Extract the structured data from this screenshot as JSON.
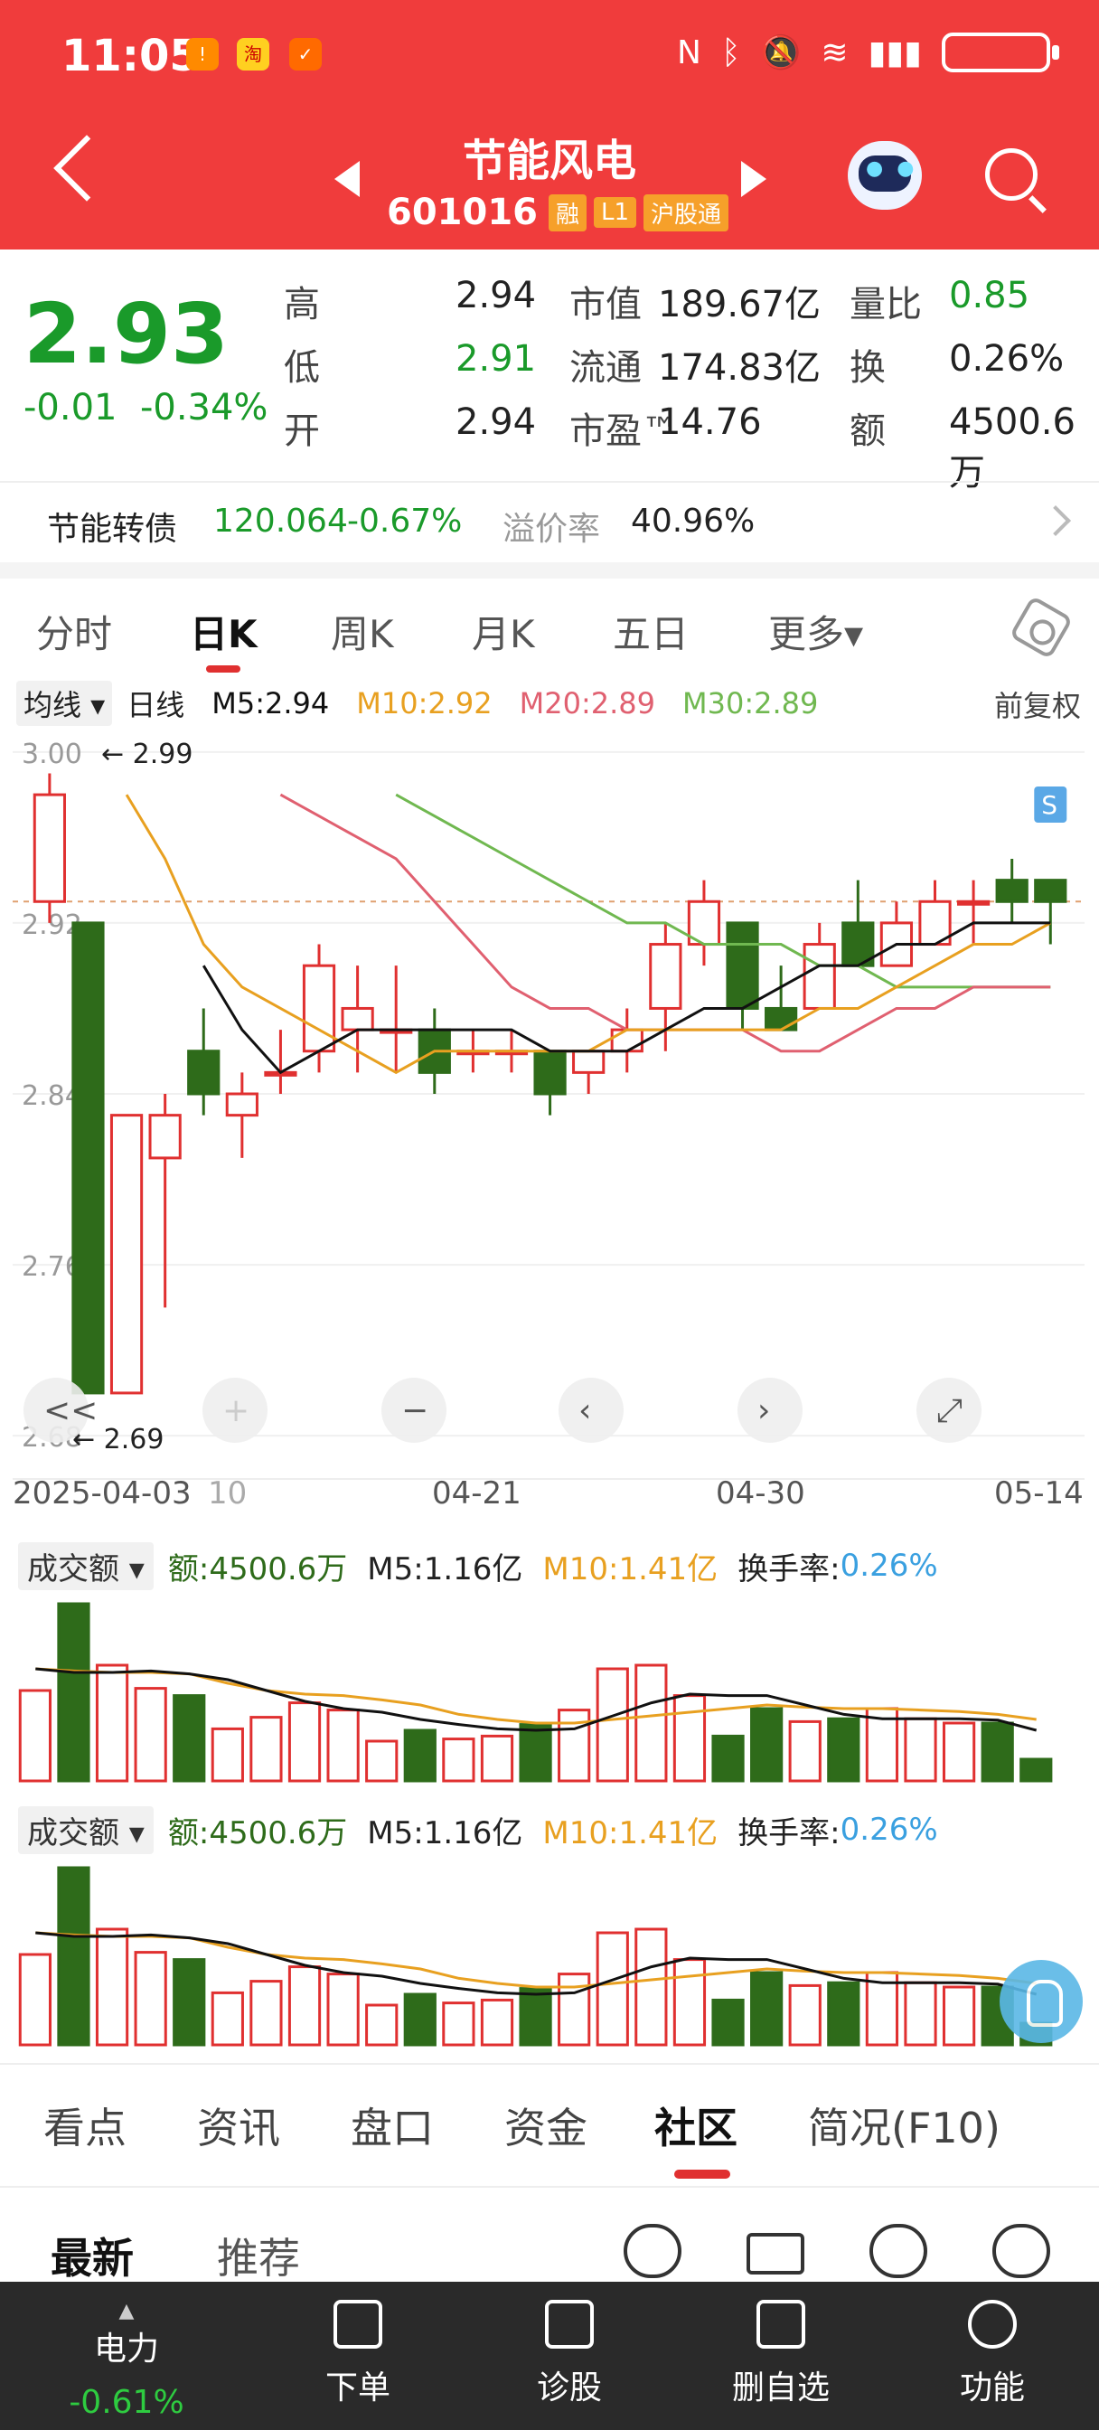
{
  "status": {
    "time": "11:05"
  },
  "header": {
    "title": "节能风电",
    "code": "601016",
    "tags": [
      "融",
      "L1",
      "沪股通"
    ]
  },
  "quote": {
    "price": "2.93",
    "change": "-0.01",
    "change_pct": "-0.34%",
    "rows": [
      {
        "label": "高",
        "value": "2.94",
        "label2": "市值",
        "value2": "189.67亿",
        "label3": "量比",
        "value3": "0.85"
      },
      {
        "label": "低",
        "value": "2.91",
        "label2": "流通",
        "value2": "174.83亿",
        "label3": "换",
        "value3": "0.26%"
      },
      {
        "label": "开",
        "value": "2.94",
        "label2": "市盈™",
        "value2": "14.76",
        "label3": "额",
        "value3": "4500.6万"
      }
    ]
  },
  "convertible": {
    "name": "节能转债",
    "price": "120.064",
    "pct": "-0.67%",
    "premium_label": "溢价率",
    "premium": "40.96%"
  },
  "ktabs": [
    "分时",
    "日K",
    "周K",
    "月K",
    "五日",
    "更多▾"
  ],
  "ma": {
    "select": "均线 ▾",
    "period": "日线",
    "m5": "M5:2.94",
    "m10": "M10:2.92",
    "m20": "M20:2.89",
    "m30": "M30:2.89",
    "adj": "前复权"
  },
  "colors": {
    "up": "#e03030",
    "down": "#2e6b1a",
    "m5": "#111111",
    "m10": "#e8a020",
    "m20": "#e06070",
    "m30": "#70b850"
  },
  "chart_data": {
    "type": "candlestick",
    "y_ticks": [
      "3.00",
      "2.92",
      "2.84",
      "2.76",
      "2.68"
    ],
    "ylim": [
      2.675,
      3.005
    ],
    "max_marker": "2.99",
    "min_marker": "2.69",
    "dates": [
      "2025-04-03",
      "04-21",
      "04-30",
      "05-14"
    ],
    "date_partial": "10",
    "candles": [
      {
        "o": 2.93,
        "h": 2.99,
        "l": 2.92,
        "c": 2.98
      },
      {
        "o": 2.92,
        "h": 2.92,
        "l": 2.7,
        "c": 2.7
      },
      {
        "o": 2.7,
        "h": 2.83,
        "l": 2.7,
        "c": 2.83
      },
      {
        "o": 2.81,
        "h": 2.84,
        "l": 2.74,
        "c": 2.83
      },
      {
        "o": 2.86,
        "h": 2.88,
        "l": 2.83,
        "c": 2.84
      },
      {
        "o": 2.83,
        "h": 2.85,
        "l": 2.81,
        "c": 2.84
      },
      {
        "o": 2.85,
        "h": 2.87,
        "l": 2.84,
        "c": 2.85
      },
      {
        "o": 2.86,
        "h": 2.91,
        "l": 2.85,
        "c": 2.9
      },
      {
        "o": 2.87,
        "h": 2.9,
        "l": 2.85,
        "c": 2.88
      },
      {
        "o": 2.87,
        "h": 2.9,
        "l": 2.85,
        "c": 2.87
      },
      {
        "o": 2.87,
        "h": 2.88,
        "l": 2.84,
        "c": 2.85
      },
      {
        "o": 2.86,
        "h": 2.87,
        "l": 2.85,
        "c": 2.86
      },
      {
        "o": 2.86,
        "h": 2.87,
        "l": 2.85,
        "c": 2.86
      },
      {
        "o": 2.86,
        "h": 2.86,
        "l": 2.83,
        "c": 2.84
      },
      {
        "o": 2.85,
        "h": 2.86,
        "l": 2.84,
        "c": 2.86
      },
      {
        "o": 2.86,
        "h": 2.88,
        "l": 2.85,
        "c": 2.87
      },
      {
        "o": 2.88,
        "h": 2.92,
        "l": 2.86,
        "c": 2.91
      },
      {
        "o": 2.91,
        "h": 2.94,
        "l": 2.9,
        "c": 2.93
      },
      {
        "o": 2.92,
        "h": 2.92,
        "l": 2.87,
        "c": 2.88
      },
      {
        "o": 2.88,
        "h": 2.9,
        "l": 2.87,
        "c": 2.87
      },
      {
        "o": 2.88,
        "h": 2.92,
        "l": 2.88,
        "c": 2.91
      },
      {
        "o": 2.92,
        "h": 2.94,
        "l": 2.9,
        "c": 2.9
      },
      {
        "o": 2.9,
        "h": 2.93,
        "l": 2.9,
        "c": 2.92
      },
      {
        "o": 2.91,
        "h": 2.94,
        "l": 2.91,
        "c": 2.93
      },
      {
        "o": 2.93,
        "h": 2.94,
        "l": 2.91,
        "c": 2.93
      },
      {
        "o": 2.94,
        "h": 2.95,
        "l": 2.92,
        "c": 2.93
      },
      {
        "o": 2.94,
        "h": 2.94,
        "l": 2.91,
        "c": 2.93
      }
    ],
    "m5": [
      null,
      null,
      null,
      null,
      2.9,
      2.87,
      2.85,
      2.86,
      2.87,
      2.87,
      2.87,
      2.87,
      2.87,
      2.86,
      2.86,
      2.86,
      2.87,
      2.88,
      2.88,
      2.89,
      2.9,
      2.9,
      2.91,
      2.91,
      2.92,
      2.92,
      2.92
    ],
    "m10": [
      null,
      null,
      2.98,
      2.95,
      2.91,
      2.89,
      2.88,
      2.87,
      2.86,
      2.85,
      2.86,
      2.86,
      2.86,
      2.86,
      2.86,
      2.87,
      2.87,
      2.87,
      2.87,
      2.87,
      2.88,
      2.88,
      2.89,
      2.9,
      2.91,
      2.91,
      2.92
    ],
    "m20": [
      null,
      null,
      null,
      null,
      null,
      null,
      2.98,
      2.97,
      2.96,
      2.95,
      2.93,
      2.91,
      2.89,
      2.88,
      2.88,
      2.87,
      2.87,
      2.87,
      2.87,
      2.86,
      2.86,
      2.87,
      2.88,
      2.88,
      2.89,
      2.89,
      2.89
    ],
    "m30": [
      null,
      null,
      null,
      null,
      null,
      null,
      null,
      null,
      null,
      2.98,
      2.97,
      2.96,
      2.95,
      2.94,
      2.93,
      2.92,
      2.92,
      2.91,
      2.91,
      2.91,
      2.9,
      2.9,
      2.89,
      2.89,
      2.89,
      2.89,
      2.89
    ],
    "signal": "S"
  },
  "volume": {
    "label": "成交额 ▾",
    "amount": "额:4500.6万",
    "m5": "M5:1.16亿",
    "m10": "M10:1.41亿",
    "turnover_label": "换手率:",
    "turnover": "0.26%",
    "values": [
      1.25,
      2.45,
      1.6,
      1.28,
      1.18,
      0.72,
      0.88,
      1.08,
      0.98,
      0.55,
      0.7,
      0.58,
      0.62,
      0.78,
      0.98,
      1.55,
      1.6,
      1.18,
      0.62,
      1.0,
      0.82,
      0.86,
      1.0,
      0.86,
      0.8,
      0.8,
      0.3
    ],
    "m5_line": [
      1.55,
      1.5,
      1.5,
      1.52,
      1.48,
      1.4,
      1.25,
      1.1,
      1.0,
      0.95,
      0.85,
      0.78,
      0.72,
      0.7,
      0.72,
      0.9,
      1.08,
      1.2,
      1.18,
      1.18,
      1.05,
      0.92,
      0.86,
      0.86,
      0.86,
      0.84,
      0.7
    ],
    "m10_line": [
      1.55,
      1.52,
      1.5,
      1.5,
      1.48,
      1.35,
      1.25,
      1.2,
      1.18,
      1.12,
      1.05,
      0.92,
      0.85,
      0.8,
      0.8,
      0.85,
      0.9,
      0.95,
      1.0,
      1.05,
      1.02,
      1.0,
      1.0,
      0.98,
      0.96,
      0.92,
      0.85
    ]
  },
  "sections": [
    "看点",
    "资讯",
    "盘口",
    "资金",
    "社区",
    "简况(F10)"
  ],
  "subtabs": [
    "最新",
    "推荐"
  ],
  "nav": [
    {
      "label": "电力",
      "value": "-0.61%"
    },
    {
      "label": "下单"
    },
    {
      "label": "诊股"
    },
    {
      "label": "删自选"
    },
    {
      "label": "功能"
    }
  ]
}
